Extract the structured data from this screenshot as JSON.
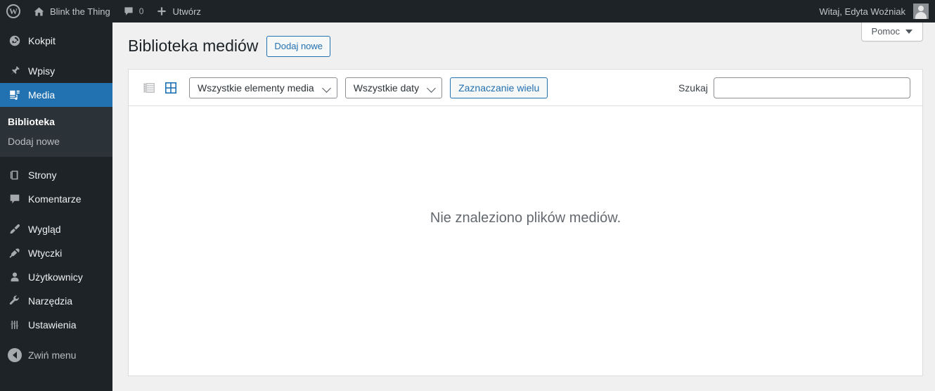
{
  "adminbar": {
    "logo_icon": "wordpress-logo-icon",
    "home_icon": "home-icon",
    "site_name": "Blink the Thing",
    "comments_icon": "comment-bubble-icon",
    "comments_count": "0",
    "new_icon": "plus-icon",
    "new_label": "Utwórz",
    "greeting": "Witaj, Edyta Woźniak",
    "avatar_icon": "avatar-icon"
  },
  "sidebar": {
    "items": [
      {
        "label": "Kokpit",
        "icon": "dashboard-icon",
        "current": false
      },
      {
        "label": "Wpisy",
        "icon": "pin-icon",
        "current": false
      },
      {
        "label": "Media",
        "icon": "media-icon",
        "current": true
      },
      {
        "label": "Strony",
        "icon": "page-icon",
        "current": false
      },
      {
        "label": "Komentarze",
        "icon": "comment-icon",
        "current": false
      },
      {
        "label": "Wygląd",
        "icon": "brush-icon",
        "current": false
      },
      {
        "label": "Wtyczki",
        "icon": "plug-icon",
        "current": false
      },
      {
        "label": "Użytkownicy",
        "icon": "user-icon",
        "current": false
      },
      {
        "label": "Narzędzia",
        "icon": "wrench-icon",
        "current": false
      },
      {
        "label": "Ustawienia",
        "icon": "settings-icon",
        "current": false
      }
    ],
    "submenu": {
      "parent": "Media",
      "items": [
        {
          "label": "Biblioteka",
          "current": true
        },
        {
          "label": "Dodaj nowe",
          "current": false
        }
      ]
    },
    "collapse": {
      "label": "Zwiń menu",
      "icon": "collapse-arrow-icon"
    }
  },
  "content": {
    "help_tab": {
      "label": "Pomoc",
      "icon": "chevron-down-icon"
    },
    "page_title": "Biblioteka mediów",
    "add_new_label": "Dodaj nowe",
    "toolbar": {
      "list_view_icon": "list-view-icon",
      "grid_view_icon": "grid-view-icon",
      "active_view": "grid",
      "media_type_filter": "Wszystkie elementy media",
      "date_filter": "Wszystkie daty",
      "bulk_select_label": "Zaznaczanie wielu",
      "search_label": "Szukaj",
      "search_value": "",
      "search_placeholder": ""
    },
    "empty_message": "Nie znaleziono plików mediów."
  },
  "colors": {
    "admin_dark": "#1d2327",
    "submenu_dark": "#2c3338",
    "accent_blue": "#2271b1",
    "content_bg": "#f0f0f1",
    "muted_text": "#646970"
  }
}
